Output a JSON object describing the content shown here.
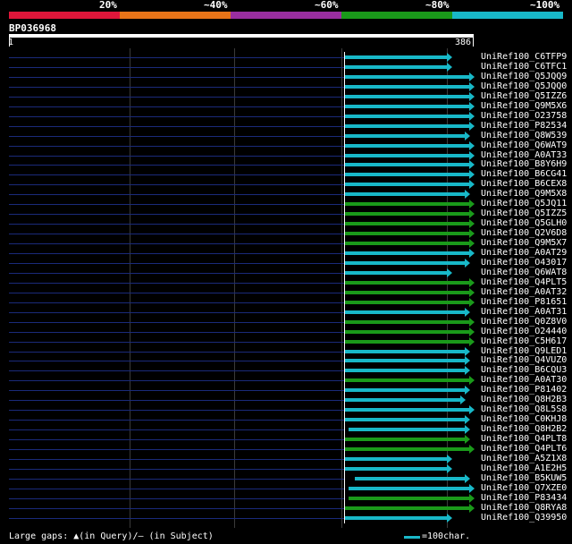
{
  "legend": {
    "labels": [
      "20%",
      "~40%",
      "~60%",
      "~80%",
      "~100%"
    ],
    "colors": [
      "#e0163a",
      "#e87418",
      "#9a2ea0",
      "#1a9a1a",
      "#18b8c8"
    ]
  },
  "query": {
    "id": "BP036968",
    "start": "1",
    "end": "386"
  },
  "hits": [
    {
      "label": "UniRef100_C6TFP9",
      "color": "#18b8c8",
      "end": 500
    },
    {
      "label": "UniRef100_C6TFC1",
      "color": "#18b8c8",
      "end": 500
    },
    {
      "label": "UniRef100_Q5JQQ9",
      "color": "#18b8c8",
      "end": 525
    },
    {
      "label": "UniRef100_Q5JQQ0",
      "color": "#18b8c8",
      "end": 525
    },
    {
      "label": "UniRef100_Q5IZZ6",
      "color": "#18b8c8",
      "end": 525
    },
    {
      "label": "UniRef100_Q9M5X6",
      "color": "#18b8c8",
      "end": 525
    },
    {
      "label": "UniRef100_O23758",
      "color": "#18b8c8",
      "end": 525
    },
    {
      "label": "UniRef100_P82534",
      "color": "#18b8c8",
      "end": 525
    },
    {
      "label": "UniRef100_Q8W539",
      "color": "#18b8c8",
      "end": 520
    },
    {
      "label": "UniRef100_Q6WAT9",
      "color": "#18b8c8",
      "end": 525
    },
    {
      "label": "UniRef100_A0AT33",
      "color": "#18b8c8",
      "end": 525
    },
    {
      "label": "UniRef100_B8Y6H9",
      "color": "#18b8c8",
      "end": 525
    },
    {
      "label": "UniRef100_B6CG41",
      "color": "#18b8c8",
      "end": 525
    },
    {
      "label": "UniRef100_B6CEX8",
      "color": "#18b8c8",
      "end": 525
    },
    {
      "label": "UniRef100_Q9M5X8",
      "color": "#18b8c8",
      "end": 520
    },
    {
      "label": "UniRef100_Q5JQ11",
      "color": "#1a9a1a",
      "end": 525
    },
    {
      "label": "UniRef100_Q5IZZ5",
      "color": "#1a9a1a",
      "end": 525
    },
    {
      "label": "UniRef100_Q5GLH0",
      "color": "#1a9a1a",
      "end": 525
    },
    {
      "label": "UniRef100_Q2V6D8",
      "color": "#1a9a1a",
      "end": 525
    },
    {
      "label": "UniRef100_Q9M5X7",
      "color": "#1a9a1a",
      "end": 525
    },
    {
      "label": "UniRef100_A0AT29",
      "color": "#18b8c8",
      "end": 525
    },
    {
      "label": "UniRef100_O43017",
      "color": "#18b8c8",
      "end": 520
    },
    {
      "label": "UniRef100_Q6WAT8",
      "color": "#18b8c8",
      "end": 500
    },
    {
      "label": "UniRef100_Q4PLT5",
      "color": "#1a9a1a",
      "end": 525
    },
    {
      "label": "UniRef100_A0AT32",
      "color": "#1a9a1a",
      "end": 525
    },
    {
      "label": "UniRef100_P81651",
      "color": "#1a9a1a",
      "end": 525
    },
    {
      "label": "UniRef100_A0AT31",
      "color": "#18b8c8",
      "end": 520
    },
    {
      "label": "UniRef100_Q0Z8V0",
      "color": "#1a9a1a",
      "end": 525
    },
    {
      "label": "UniRef100_O24440",
      "color": "#1a9a1a",
      "end": 525
    },
    {
      "label": "UniRef100_C5H617",
      "color": "#1a9a1a",
      "end": 525
    },
    {
      "label": "UniRef100_Q9LED1",
      "color": "#18b8c8",
      "end": 520
    },
    {
      "label": "UniRef100_Q4VUZ0",
      "color": "#18b8c8",
      "end": 520
    },
    {
      "label": "UniRef100_B6CQU3",
      "color": "#18b8c8",
      "end": 520
    },
    {
      "label": "UniRef100_A0AT30",
      "color": "#1a9a1a",
      "end": 525
    },
    {
      "label": "UniRef100_P81402",
      "color": "#18b8c8",
      "end": 520
    },
    {
      "label": "UniRef100_Q8H2B3",
      "color": "#18b8c8",
      "end": 515
    },
    {
      "label": "UniRef100_Q8L5S8",
      "color": "#18b8c8",
      "end": 525
    },
    {
      "label": "UniRef100_C0KHJ8",
      "color": "#18b8c8",
      "end": 520
    },
    {
      "label": "UniRef100_Q8H2B2",
      "color": "#18b8c8",
      "end": 520,
      "start": 390,
      "tick": true
    },
    {
      "label": "UniRef100_Q4PLT8",
      "color": "#1a9a1a",
      "end": 520
    },
    {
      "label": "UniRef100_Q4PLT6",
      "color": "#1a9a1a",
      "end": 525
    },
    {
      "label": "UniRef100_A5Z1X8",
      "color": "#18b8c8",
      "end": 500
    },
    {
      "label": "UniRef100_A1E2H5",
      "color": "#18b8c8",
      "end": 500
    },
    {
      "label": "UniRef100_B5KUW5",
      "color": "#18b8c8",
      "end": 520,
      "start": 397,
      "tick": true
    },
    {
      "label": "UniRef100_Q7XZE0",
      "color": "#18b8c8",
      "end": 525,
      "start": 390,
      "tick": true
    },
    {
      "label": "UniRef100_P83434",
      "color": "#1a9a1a",
      "end": 525,
      "start": 390,
      "tick": true
    },
    {
      "label": "UniRef100_Q8RYA8",
      "color": "#1a9a1a",
      "end": 525
    },
    {
      "label": "UniRef100_Q39950",
      "color": "#18b8c8",
      "end": 500
    }
  ],
  "footer": {
    "left": "Large gaps: ▲(in Query)/– (in Subject)",
    "key_label": "=100char."
  }
}
